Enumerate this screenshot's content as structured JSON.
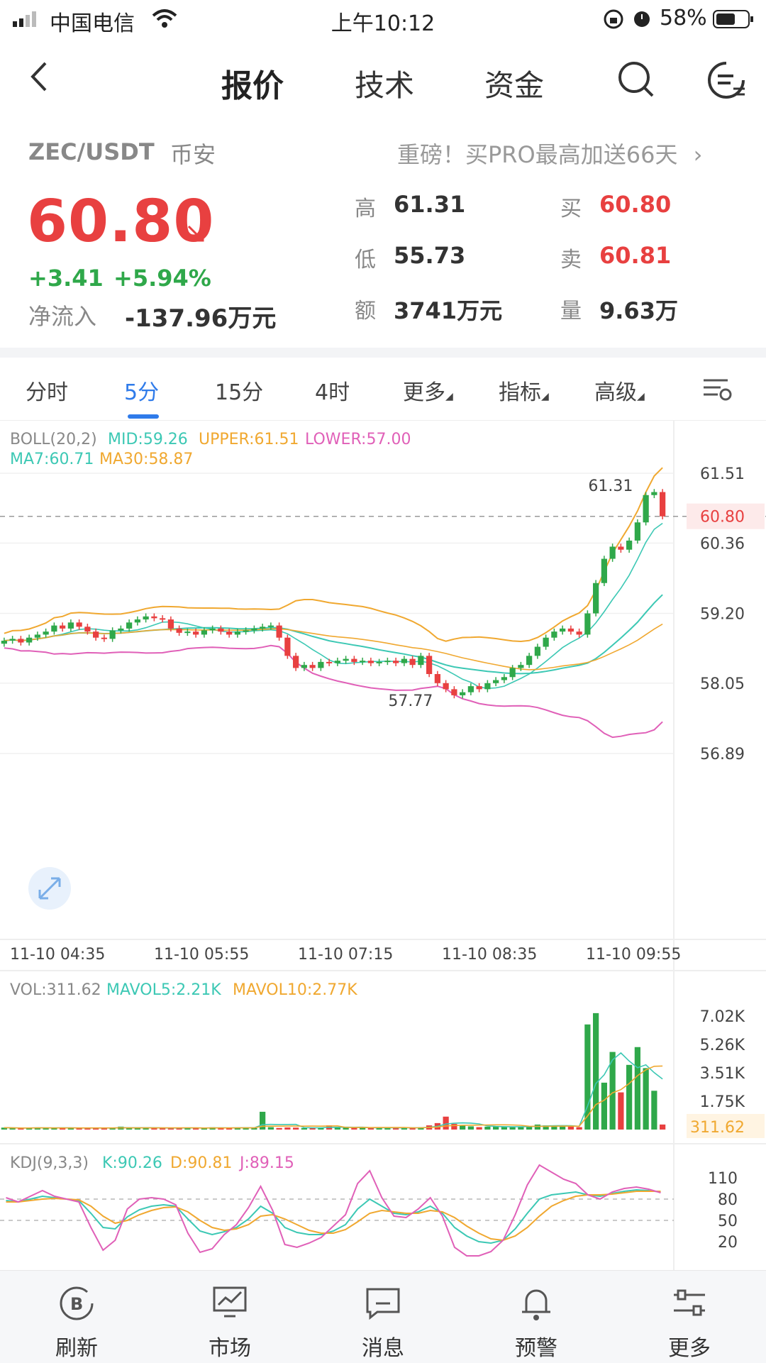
{
  "status": {
    "carrier": "中国电信",
    "time": "上午10:12",
    "battery": "58%"
  },
  "nav": {
    "tabs": [
      "报价",
      "技术",
      "资金"
    ],
    "active": 0
  },
  "quote": {
    "pair": "ZEC/USDT",
    "exchange": "币安",
    "promo": "重磅！买PRO最高加送66天",
    "price": "60.80",
    "change": "+3.41",
    "change_pct": "+5.94%",
    "net_inflow_label": "净流入",
    "net_inflow": "-137.96万元",
    "high_label": "高",
    "high": "61.31",
    "low_label": "低",
    "low": "55.73",
    "amount_label": "额",
    "amount": "3741万元",
    "buy_label": "买",
    "buy": "60.80",
    "sell_label": "卖",
    "sell": "60.81",
    "volume_label": "量",
    "volume": "9.63万"
  },
  "tabs": [
    "分时",
    "5分",
    "15分",
    "4时",
    "更多",
    "指标",
    "高级"
  ],
  "active_tab": "5分",
  "colors": {
    "up": "#e84040",
    "down": "#2fa84a",
    "accent": "#2f7bea",
    "mid": "#3cc8b4",
    "upper": "#f0a830",
    "lower": "#e060b8"
  },
  "chart_data": [
    {
      "type": "candlestick",
      "legend": {
        "boll": "BOLL(20,2)",
        "mid": "MID:59.26",
        "upper": "UPPER:61.51",
        "lower": "LOWER:57.00",
        "ma7": "MA7:60.71",
        "ma30": "MA30:58.87"
      },
      "y_ticks": [
        "61.51",
        "60.80",
        "60.36",
        "59.20",
        "58.05",
        "56.89"
      ],
      "ylim": [
        56.89,
        61.51
      ],
      "x_labels": [
        "11-10 04:35",
        "11-10 05:55",
        "11-10 07:15",
        "11-10 08:35",
        "11-10 09:55"
      ],
      "annotations": {
        "high": "61.31",
        "low": "57.77"
      },
      "last_price": "60.80",
      "closes": [
        58.75,
        58.78,
        58.72,
        58.8,
        58.85,
        58.9,
        59.0,
        58.95,
        59.05,
        58.98,
        58.9,
        58.8,
        58.78,
        58.92,
        58.95,
        59.05,
        59.1,
        59.15,
        59.12,
        59.1,
        58.95,
        58.88,
        58.9,
        58.85,
        58.92,
        58.95,
        58.9,
        58.85,
        58.9,
        58.92,
        58.95,
        58.98,
        59.0,
        58.8,
        58.5,
        58.3,
        58.35,
        58.3,
        58.4,
        58.38,
        58.42,
        58.45,
        58.4,
        58.42,
        58.38,
        58.4,
        58.42,
        58.38,
        58.45,
        58.35,
        58.5,
        58.2,
        58.05,
        57.95,
        57.85,
        57.9,
        58.0,
        57.95,
        58.05,
        58.1,
        58.15,
        58.3,
        58.35,
        58.5,
        58.65,
        58.8,
        58.9,
        58.95,
        58.9,
        58.85,
        59.2,
        59.7,
        60.1,
        60.3,
        60.25,
        60.4,
        60.7,
        61.15,
        61.2,
        60.8
      ]
    },
    {
      "type": "bar",
      "legend": {
        "vol": "VOL:311.62",
        "mavol5": "MAVOL5:2.21K",
        "mavol10": "MAVOL10:2.77K"
      },
      "y_ticks": [
        "7.02K",
        "5.26K",
        "3.51K",
        "1.75K"
      ],
      "last": "311.62",
      "values": [
        120,
        90,
        80,
        100,
        130,
        110,
        90,
        95,
        100,
        85,
        120,
        90,
        80,
        100,
        180,
        110,
        90,
        85,
        95,
        120,
        100,
        90,
        110,
        80,
        95,
        140,
        100,
        90,
        130,
        120,
        95,
        1100,
        150,
        100,
        130,
        120,
        90,
        110,
        100,
        260,
        140,
        110,
        100,
        120,
        95,
        130,
        120,
        100,
        90,
        110,
        140,
        260,
        400,
        800,
        350,
        250,
        200,
        150,
        180,
        200,
        170,
        150,
        180,
        220,
        310,
        260,
        230,
        200,
        180,
        150,
        6500,
        7200,
        2900,
        4800,
        2300,
        4000,
        5100,
        3800,
        2400,
        312
      ]
    },
    {
      "type": "line",
      "legend": {
        "kdj": "KDJ(9,3,3)",
        "k": "K:90.26",
        "d": "D:90.81",
        "j": "J:89.15"
      },
      "y_ticks": [
        "110",
        "80",
        "50",
        "20"
      ],
      "series": [
        {
          "name": "K",
          "values": [
            78,
            76,
            80,
            84,
            82,
            80,
            78,
            60,
            40,
            38,
            55,
            65,
            70,
            72,
            70,
            52,
            35,
            30,
            34,
            40,
            52,
            70,
            60,
            40,
            33,
            30,
            30,
            35,
            44,
            66,
            80,
            70,
            60,
            58,
            62,
            70,
            60,
            40,
            28,
            20,
            18,
            22,
            38,
            60,
            80,
            86,
            88,
            90,
            86,
            84,
            88,
            91,
            93,
            92,
            90
          ]
        },
        {
          "name": "D",
          "values": [
            76,
            76,
            78,
            80,
            81,
            80,
            79,
            70,
            56,
            46,
            50,
            58,
            64,
            68,
            69,
            62,
            50,
            40,
            36,
            38,
            44,
            56,
            58,
            52,
            44,
            36,
            32,
            32,
            37,
            48,
            60,
            64,
            62,
            60,
            60,
            64,
            62,
            54,
            42,
            32,
            24,
            22,
            28,
            40,
            56,
            70,
            78,
            84,
            86,
            86,
            87,
            89,
            91,
            91,
            91
          ]
        },
        {
          "name": "J",
          "values": [
            82,
            76,
            84,
            92,
            84,
            80,
            76,
            40,
            8,
            22,
            66,
            80,
            82,
            80,
            72,
            32,
            5,
            10,
            30,
            44,
            68,
            98,
            64,
            16,
            12,
            18,
            26,
            42,
            58,
            102,
            120,
            82,
            56,
            54,
            66,
            82,
            56,
            12,
            0,
            0,
            6,
            22,
            58,
            100,
            128,
            118,
            108,
            102,
            86,
            80,
            90,
            95,
            97,
            94,
            89
          ]
        }
      ]
    }
  ],
  "bottom_nav": [
    "刷新",
    "市场",
    "消息",
    "预警",
    "更多"
  ]
}
